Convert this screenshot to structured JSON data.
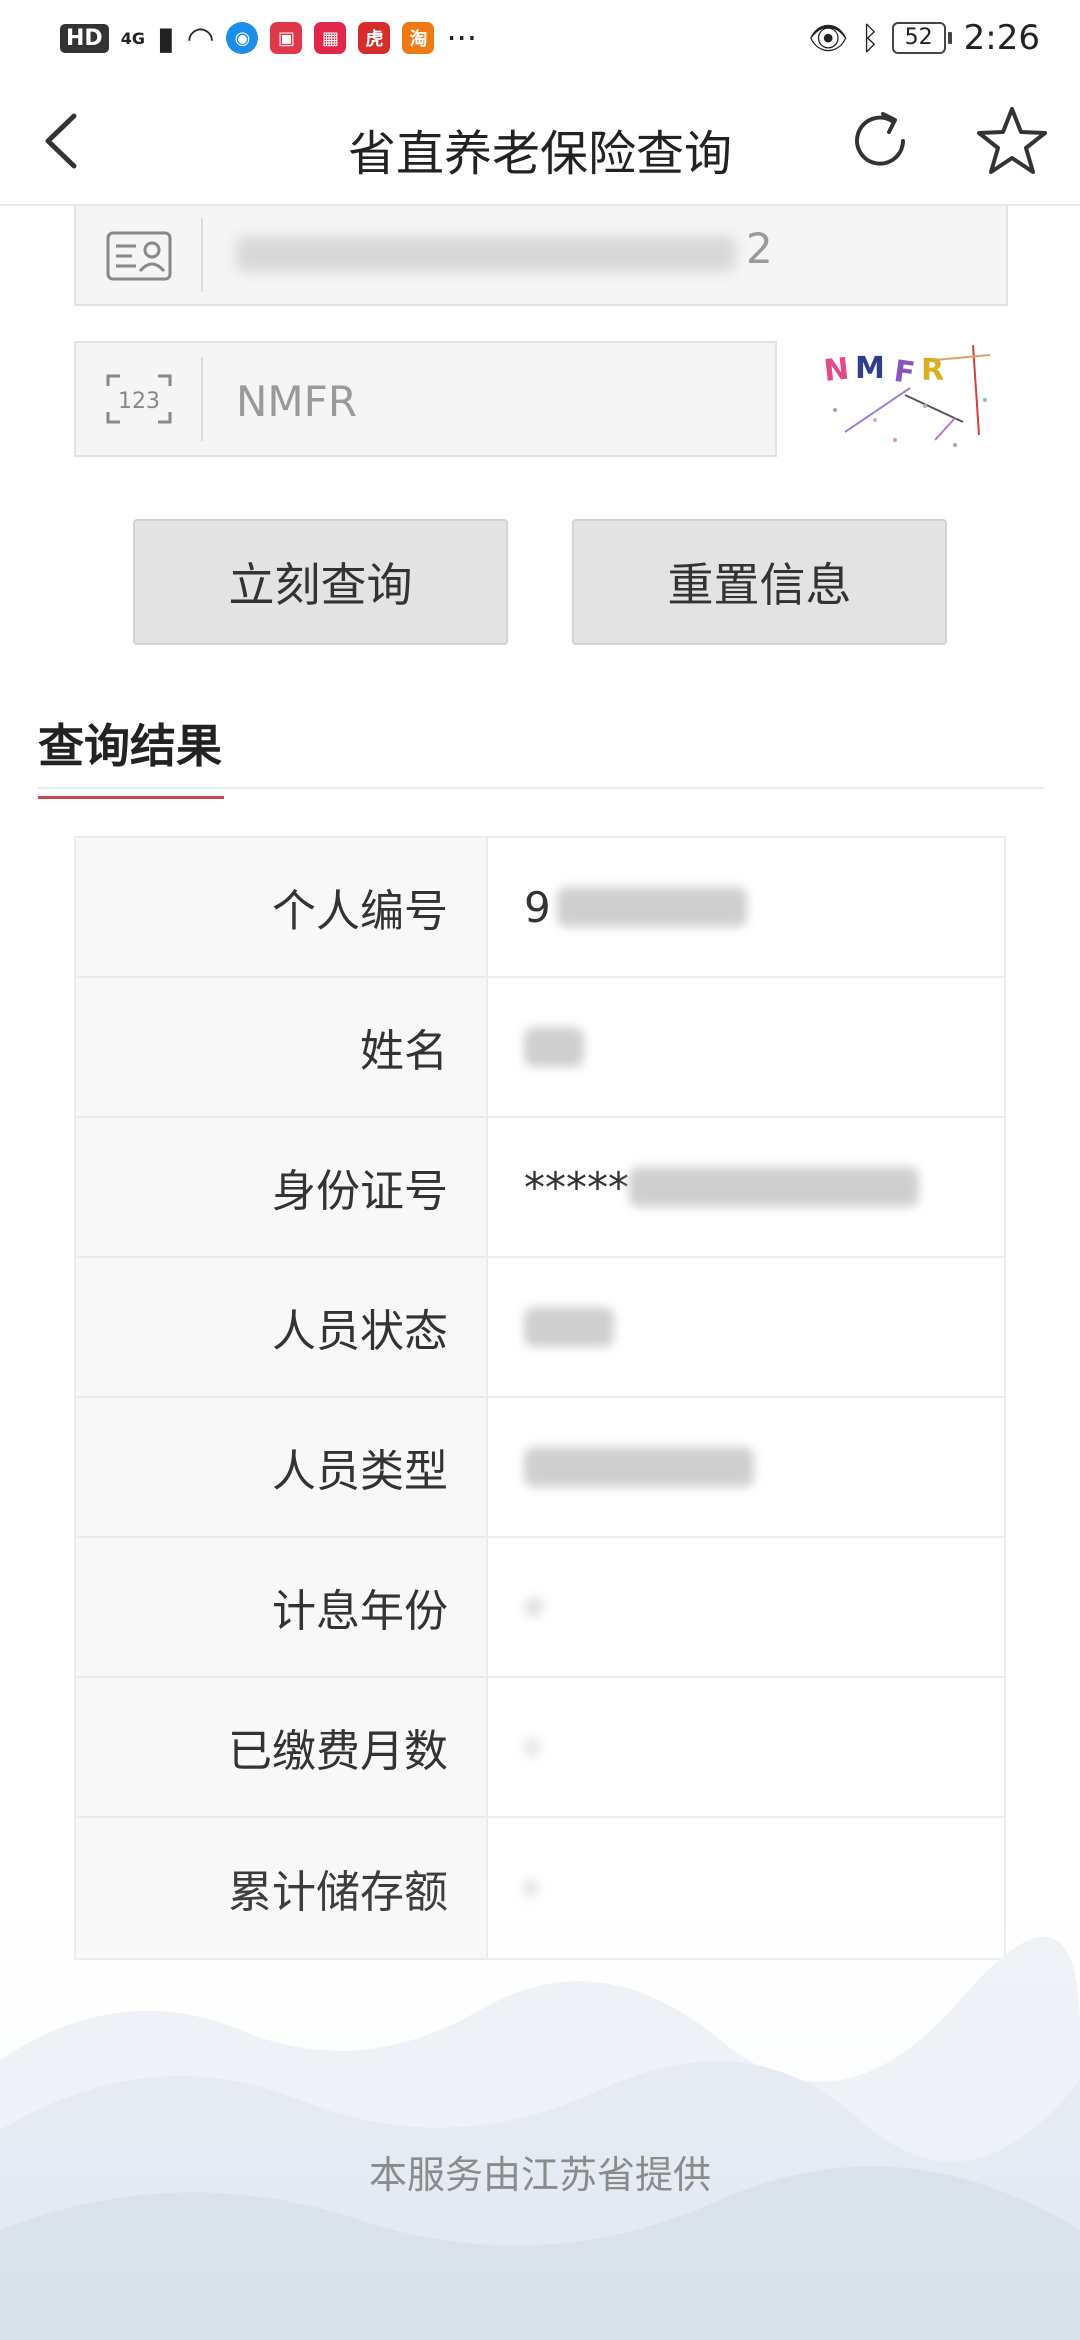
{
  "status_bar": {
    "hd": "HD",
    "signal": "4G",
    "apps": [
      {
        "name": "reader-app-icon",
        "color": "#e0374b",
        "glyph": "▣"
      },
      {
        "name": "shop-app-icon",
        "color": "#e3274a",
        "glyph": "▦"
      },
      {
        "name": "huya-app-icon",
        "color": "#d72c2c",
        "glyph": "虎"
      },
      {
        "name": "taobao-app-icon",
        "color": "#f07a12",
        "glyph": "淘"
      }
    ],
    "more": "···",
    "battery": "52",
    "time": "2:26"
  },
  "header": {
    "title": "省直养老保险查询"
  },
  "form": {
    "id_value_tail": "2",
    "code_value": "NMFR",
    "captcha_text": "NMFR"
  },
  "buttons": {
    "query": "立刻查询",
    "reset": "重置信息"
  },
  "results": {
    "title": "查询结果",
    "rows": [
      {
        "label": "个人编号",
        "value": "9"
      },
      {
        "label": "姓名",
        "value": ""
      },
      {
        "label": "身份证号",
        "value": "*****"
      },
      {
        "label": "人员状态",
        "value": ""
      },
      {
        "label": "人员类型",
        "value": ""
      },
      {
        "label": "计息年份",
        "value": ""
      },
      {
        "label": "已缴费月数",
        "value": ""
      },
      {
        "label": "累计储存额",
        "value": ""
      }
    ]
  },
  "footer": {
    "text": "本服务由江苏省提供"
  }
}
